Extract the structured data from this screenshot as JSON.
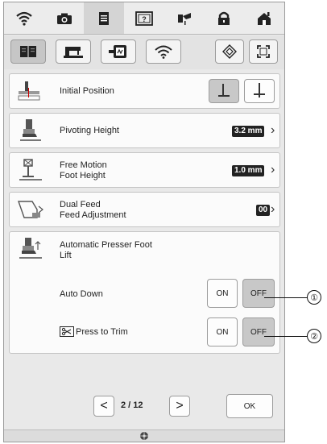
{
  "topbar": {
    "icons": [
      "wifi-icon",
      "camera-icon",
      "document-icon",
      "help-icon",
      "needle-icon",
      "lock-icon",
      "home-icon"
    ],
    "active_index": 2
  },
  "categories": {
    "icons": [
      "book-settings-icon",
      "sewing-machine-icon",
      "embroidery-frame-icon",
      "wireless-icon"
    ],
    "selected_index": 0,
    "right_icons": [
      "reset-diamond-icon",
      "fullscreen-icon"
    ]
  },
  "rows": {
    "initial_position": {
      "label": "Initial Position"
    },
    "pivoting_height": {
      "label": "Pivoting Height",
      "value": "3.2 mm"
    },
    "free_motion": {
      "label_line1": "Free Motion",
      "label_line2": "Foot Height",
      "value": "1.0 mm"
    },
    "dual_feed": {
      "label_line1": "Dual Feed",
      "label_line2": "Feed Adjustment",
      "value": "00"
    },
    "auto_presser": {
      "label_line1": "Automatic Presser Foot",
      "label_line2": "Lift",
      "auto_down": {
        "label": "Auto Down",
        "on": "ON",
        "off": "OFF",
        "state": "OFF"
      },
      "press_to_trim": {
        "label": "Press to Trim",
        "on": "ON",
        "off": "OFF",
        "state": "OFF"
      }
    }
  },
  "pagination": {
    "prev": "<",
    "page_text": "2 / 12",
    "next": ">"
  },
  "ok_button": "OK",
  "callouts": {
    "one": "①",
    "two": "②"
  },
  "colors": {
    "screen_bg": "#e9e9e9",
    "row_bg": "#fbfbfb",
    "selected_btn": "#c8c8c8",
    "value_box": "#222222"
  }
}
